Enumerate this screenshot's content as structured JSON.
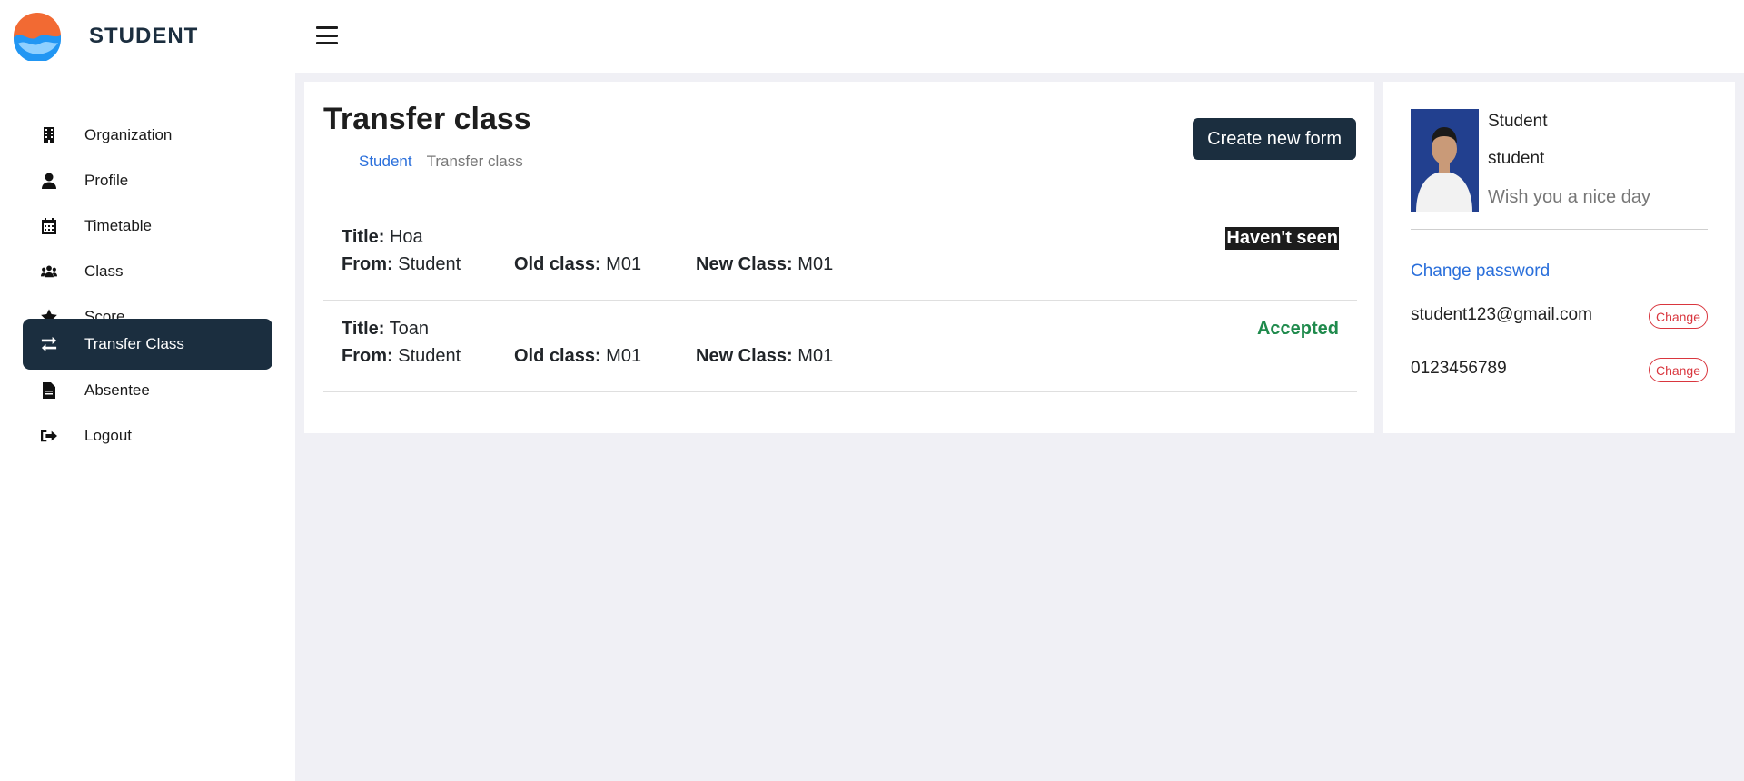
{
  "brand": {
    "name": "STUDENT"
  },
  "sidebar": {
    "items": [
      {
        "label": "Organization",
        "icon": "building-icon"
      },
      {
        "label": "Profile",
        "icon": "user-icon"
      },
      {
        "label": "Timetable",
        "icon": "calendar-icon"
      },
      {
        "label": "Class",
        "icon": "users-icon"
      },
      {
        "label": "Score",
        "icon": "star-icon"
      },
      {
        "label": "Transfer Class",
        "icon": "exchange-icon",
        "active": true
      },
      {
        "label": "Absentee",
        "icon": "file-icon"
      },
      {
        "label": "Logout",
        "icon": "logout-icon"
      }
    ]
  },
  "main": {
    "title": "Transfer class",
    "breadcrumb": {
      "link": "Student",
      "current": "Transfer class"
    },
    "create_button": "Create new form",
    "labels": {
      "title": "Title:",
      "from": "From:",
      "old_class": "Old class:",
      "new_class": "New Class:"
    },
    "forms": [
      {
        "title": "Hoa",
        "from": "Student",
        "old_class": "M01",
        "new_class": "M01",
        "status": "Haven't seen"
      },
      {
        "title": "Toan",
        "from": "Student",
        "old_class": "M01",
        "new_class": "M01",
        "status": "Accepted"
      }
    ]
  },
  "profile": {
    "name": "Student",
    "role": "student",
    "greeting": "Wish you a nice day",
    "change_password": "Change password",
    "email": "student123@gmail.com",
    "phone": "0123456789",
    "change_label": "Change"
  },
  "colors": {
    "primary_dark": "#1b2e3f",
    "link": "#2a6fdb",
    "accepted": "#1f8a4c",
    "danger": "#d9363e",
    "background": "#f0f0f5"
  }
}
